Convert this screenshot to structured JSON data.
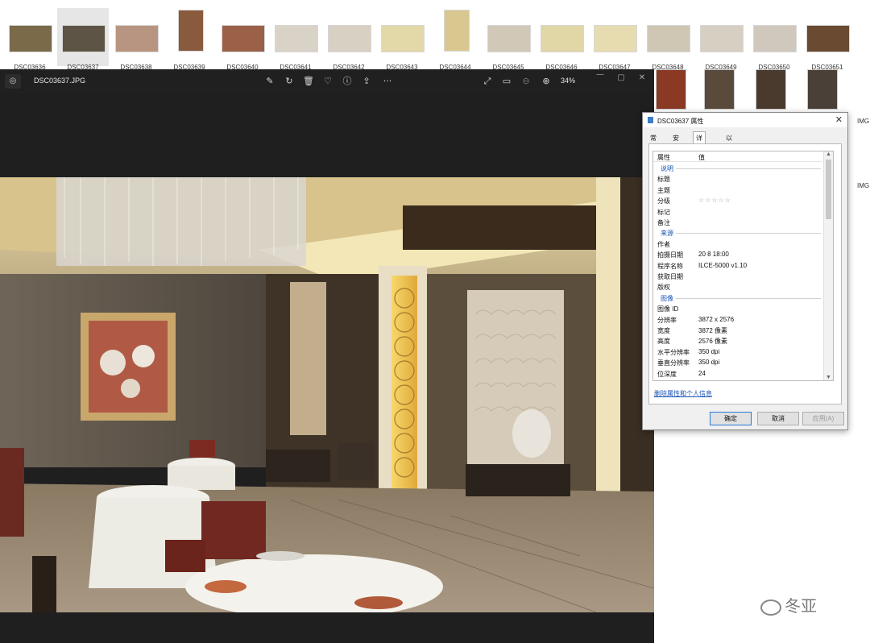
{
  "gallery": {
    "thumbnails": [
      {
        "name": "DSC03636",
        "color": "#7a6a4a"
      },
      {
        "name": "DSC03637",
        "color": "#5d5446",
        "selected": true
      },
      {
        "name": "DSC03638",
        "color": "#b89580"
      },
      {
        "name": "DSC03639",
        "color": "#8a5a3c",
        "tall": true
      },
      {
        "name": "DSC03640",
        "color": "#9a6048"
      },
      {
        "name": "DSC03641",
        "color": "#d9d2c6"
      },
      {
        "name": "DSC03642",
        "color": "#d8d0c2"
      },
      {
        "name": "DSC03643",
        "color": "#e2d8a8"
      },
      {
        "name": "DSC03644",
        "color": "#d8c890",
        "tall": true
      },
      {
        "name": "DSC03645",
        "color": "#d2c8b8"
      },
      {
        "name": "DSC03646",
        "color": "#e0d6a6"
      },
      {
        "name": "DSC03647",
        "color": "#e6dcb0"
      },
      {
        "name": "DSC03648",
        "color": "#cfc6b4"
      },
      {
        "name": "DSC03649",
        "color": "#d6cfc2"
      },
      {
        "name": "DSC03650",
        "color": "#d0c8bc"
      },
      {
        "name": "DSC03651",
        "color": "#6a4a30"
      }
    ],
    "row2_labels": [
      "IMG",
      "IMG"
    ]
  },
  "viewer": {
    "filename": "DSC03637.JPG",
    "zoom": "34%",
    "toolbar_icons": [
      "edit-icon",
      "rotate-icon",
      "delete-icon",
      "favorite-icon",
      "info-icon",
      "share-icon",
      "more-icon"
    ],
    "view_icons": [
      "fullscreen-icon",
      "actual-size-icon",
      "zoom-out-icon",
      "zoom-in-icon"
    ]
  },
  "dialog": {
    "title": "DSC03637 属性",
    "tabs": [
      "常规",
      "安全",
      "详细信息",
      "以前的版本"
    ],
    "active_tab": "详细信息",
    "header_key": "属性",
    "header_value": "值",
    "rows": [
      {
        "type": "group",
        "label": "说明"
      },
      {
        "type": "row",
        "k": "标题",
        "v": ""
      },
      {
        "type": "row",
        "k": "主题",
        "v": ""
      },
      {
        "type": "row",
        "k": "分级",
        "v": "☆☆☆☆☆",
        "stars": true
      },
      {
        "type": "row",
        "k": "标记",
        "v": ""
      },
      {
        "type": "row",
        "k": "备注",
        "v": ""
      },
      {
        "type": "group",
        "label": "来源"
      },
      {
        "type": "row",
        "k": "作者",
        "v": ""
      },
      {
        "type": "row",
        "k": "拍摄日期",
        "v": "20      8 18:00"
      },
      {
        "type": "row",
        "k": "程序名称",
        "v": "ILCE-5000 v1.10"
      },
      {
        "type": "row",
        "k": "获取日期",
        "v": ""
      },
      {
        "type": "row",
        "k": "版权",
        "v": ""
      },
      {
        "type": "group",
        "label": "图像"
      },
      {
        "type": "row",
        "k": "图像 ID",
        "v": ""
      },
      {
        "type": "row",
        "k": "分辨率",
        "v": "3872 x 2576"
      },
      {
        "type": "row",
        "k": "宽度",
        "v": "3872 像素"
      },
      {
        "type": "row",
        "k": "高度",
        "v": "2576 像素"
      },
      {
        "type": "row",
        "k": "水平分辨率",
        "v": "350 dpi"
      },
      {
        "type": "row",
        "k": "垂直分辨率",
        "v": "350 dpi"
      },
      {
        "type": "row",
        "k": "位深度",
        "v": "24"
      }
    ],
    "remove_link": "删除属性和个人信息",
    "ok": "确定",
    "cancel": "取消",
    "apply": "应用(A)"
  },
  "watermark": "冬亚"
}
